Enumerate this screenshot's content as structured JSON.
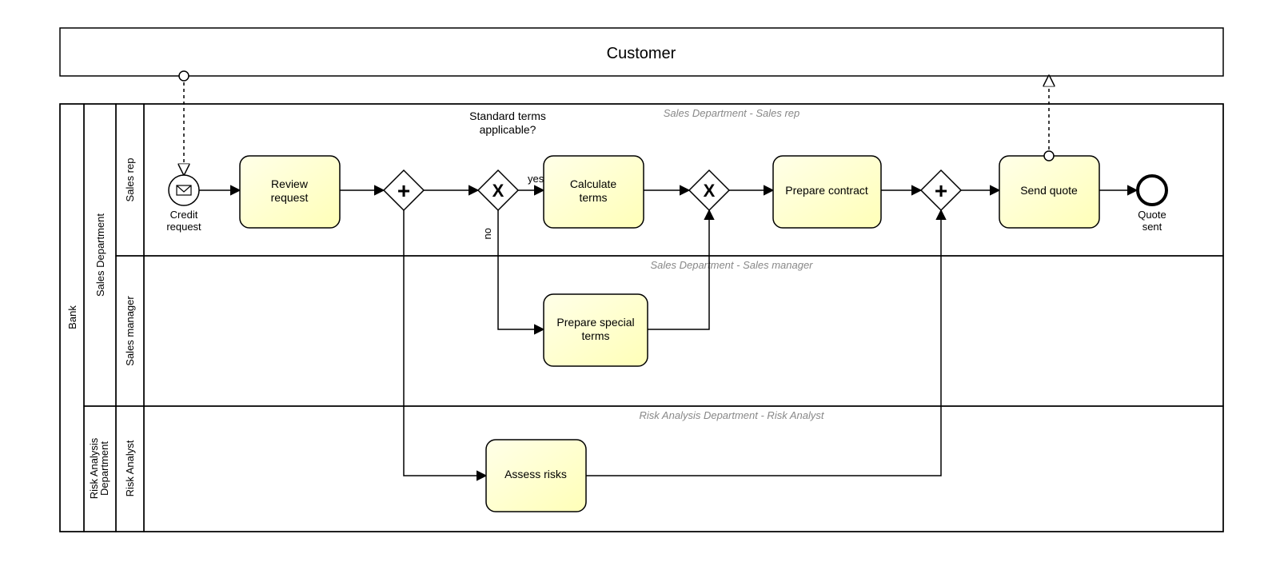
{
  "pools": {
    "customer": {
      "title": "Customer"
    },
    "bank": {
      "title": "Bank"
    }
  },
  "lanes": {
    "sales_dept": {
      "title": "Sales Department"
    },
    "sales_rep": {
      "title": "Sales rep",
      "header_text": "Sales Department - Sales rep"
    },
    "sales_manager": {
      "title": "Sales manager",
      "header_text": "Sales Department - Sales manager"
    },
    "risk_dept": {
      "title": "Risk Analysis Department"
    },
    "risk_analyst": {
      "title": "Risk Analyst",
      "header_text": "Risk Analysis Department - Risk Analyst"
    }
  },
  "events": {
    "start": {
      "label": "Credit request"
    },
    "end": {
      "label": "Quote sent"
    }
  },
  "tasks": {
    "review_request": {
      "label_line1": "Review",
      "label_line2": "request"
    },
    "calculate_terms": {
      "label_line1": "Calculate",
      "label_line2": "terms"
    },
    "prepare_contract": {
      "label": "Prepare contract"
    },
    "send_quote": {
      "label": "Send quote"
    },
    "prepare_special_terms": {
      "label_line1": "Prepare special",
      "label_line2": "terms"
    },
    "assess_risks": {
      "label": "Assess risks"
    }
  },
  "gateways": {
    "g1_parallel": {
      "symbol": "+"
    },
    "g2_exclusive_question": {
      "question_line1": "Standard terms",
      "question_line2": "applicable?",
      "yes_label": "yes",
      "no_label": "no",
      "symbol": "X"
    },
    "g3_exclusive_merge": {
      "symbol": "X"
    },
    "g4_parallel_merge": {
      "symbol": "+"
    }
  }
}
